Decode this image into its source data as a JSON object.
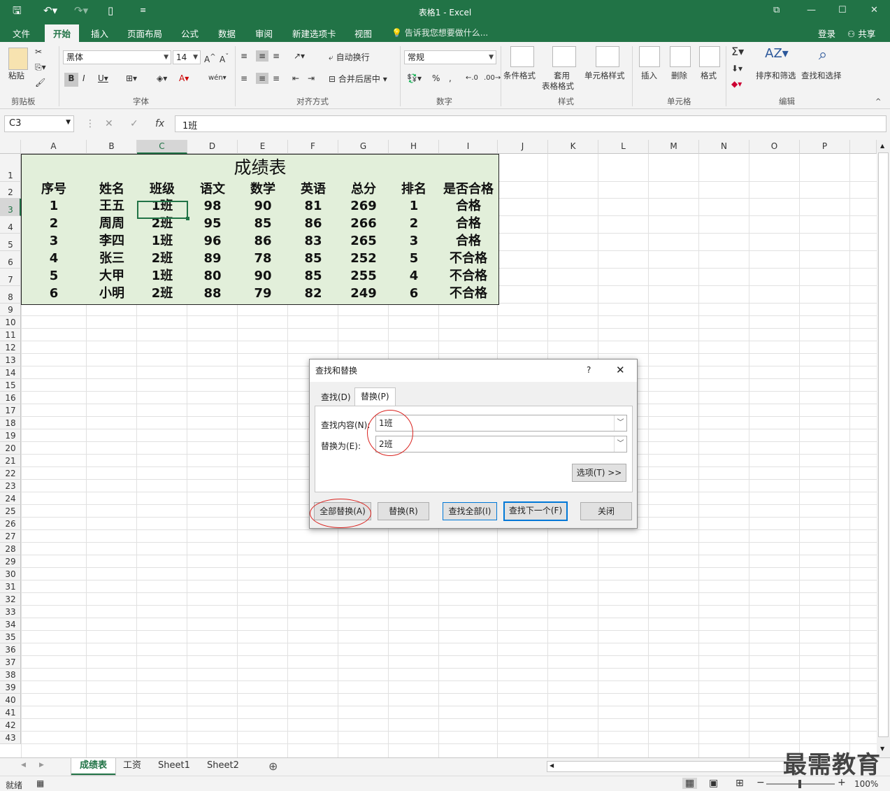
{
  "app": {
    "title": "表格1 - Excel"
  },
  "menu_tabs": [
    "文件",
    "开始",
    "插入",
    "页面布局",
    "公式",
    "数据",
    "审阅",
    "新建选项卡",
    "视图"
  ],
  "tell_me": "告诉我您想要做什么...",
  "account": {
    "login": "登录",
    "share": "共享"
  },
  "ribbon": {
    "paste": "粘贴",
    "font_name": "黑体",
    "font_size": "14",
    "wrap_text": "自动换行",
    "merge_center": "合并后居中",
    "number_format": "常规",
    "cond_format": "条件格式",
    "table_format_1": "套用",
    "table_format_2": "表格格式",
    "cell_style": "单元格样式",
    "insert": "插入",
    "delete": "删除",
    "format": "格式",
    "sort_filter": "排序和筛选",
    "find_select": "查找和选择",
    "groups": [
      "剪贴板",
      "字体",
      "对齐方式",
      "数字",
      "样式",
      "单元格",
      "编辑"
    ]
  },
  "formula": {
    "name_box": "C3",
    "content": "1班"
  },
  "columns": [
    "A",
    "B",
    "C",
    "D",
    "E",
    "F",
    "G",
    "H",
    "I",
    "J",
    "K",
    "L",
    "M",
    "N",
    "O",
    "P"
  ],
  "rows": [
    "1",
    "2",
    "3",
    "4",
    "5",
    "6",
    "7",
    "8",
    "9",
    "10",
    "11",
    "12",
    "13",
    "14",
    "15",
    "16",
    "17",
    "18",
    "19",
    "20",
    "21",
    "22",
    "23",
    "24",
    "25",
    "26",
    "27",
    "28",
    "29",
    "30",
    "31",
    "32",
    "33",
    "34",
    "35",
    "36",
    "37",
    "38",
    "39",
    "40",
    "41",
    "42",
    "43"
  ],
  "sheet": {
    "title": "成绩表",
    "headers": [
      "序号",
      "姓名",
      "班级",
      "语文",
      "数学",
      "英语",
      "总分",
      "排名",
      "是否合格"
    ],
    "data": [
      [
        "1",
        "王五",
        "1班",
        "98",
        "90",
        "81",
        "269",
        "1",
        "合格"
      ],
      [
        "2",
        "周周",
        "2班",
        "95",
        "85",
        "86",
        "266",
        "2",
        "合格"
      ],
      [
        "3",
        "李四",
        "1班",
        "96",
        "86",
        "83",
        "265",
        "3",
        "合格"
      ],
      [
        "4",
        "张三",
        "2班",
        "89",
        "78",
        "85",
        "252",
        "5",
        "不合格"
      ],
      [
        "5",
        "大甲",
        "1班",
        "80",
        "90",
        "85",
        "255",
        "4",
        "不合格"
      ],
      [
        "6",
        "小明",
        "2班",
        "88",
        "79",
        "82",
        "249",
        "6",
        "不合格"
      ]
    ]
  },
  "sheet_tabs": [
    "成绩表",
    "工资",
    "Sheet1",
    "Sheet2"
  ],
  "status": {
    "ready": "就绪",
    "zoom": "100%"
  },
  "dialog": {
    "title": "查找和替换",
    "help": "?",
    "tab_find": "查找(D)",
    "tab_replace": "替换(P)",
    "find_label": "查找内容(N):",
    "find_value": "1班",
    "replace_label": "替换为(E):",
    "replace_value": "2班",
    "options": "选项(T) >>",
    "replace_all": "全部替换(A)",
    "replace": "替换(R)",
    "find_all": "查找全部(I)",
    "find_next": "查找下一个(F)",
    "close": "关闭"
  },
  "watermark": "最需教育",
  "colors": {
    "excel_green": "#217346",
    "table_fill": "#e2efda",
    "annotation_red": "#d9231f",
    "focus_blue": "#0078d7"
  }
}
